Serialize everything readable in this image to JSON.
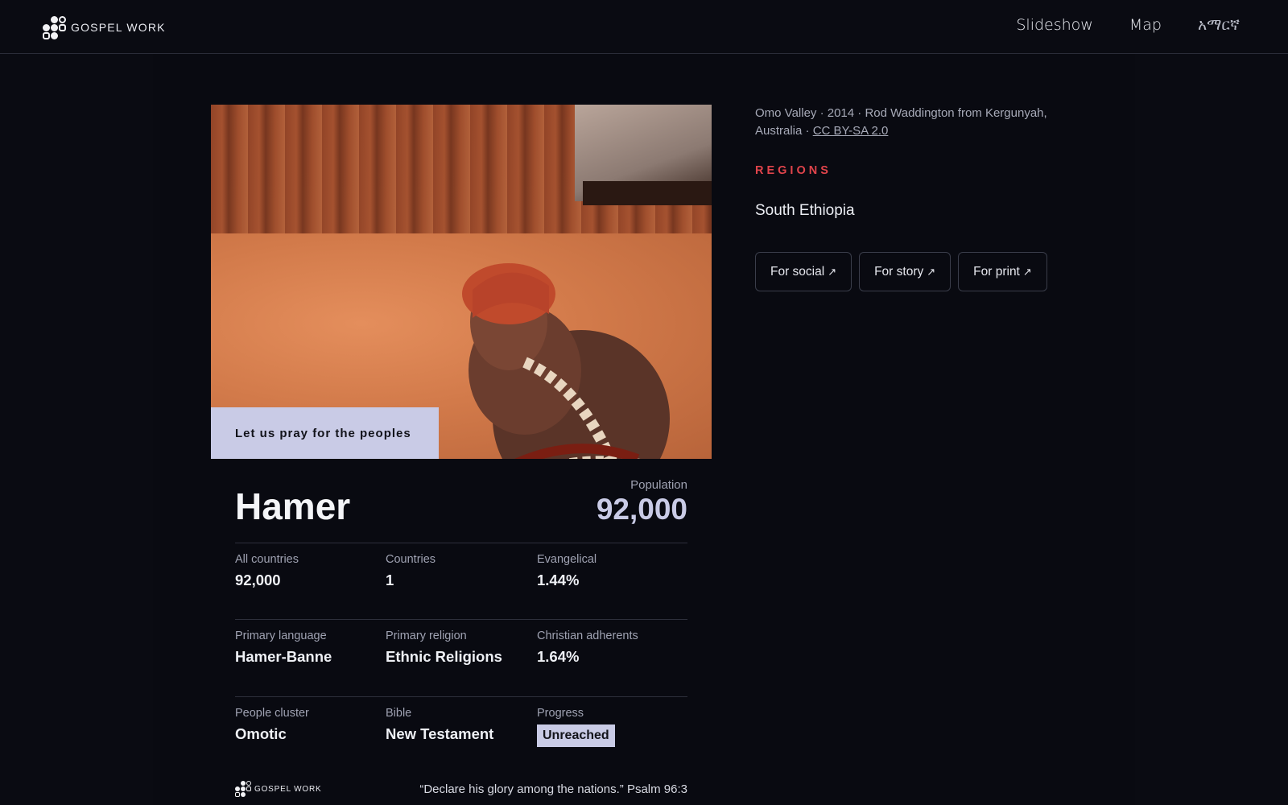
{
  "header": {
    "logo_text": "GOSPEL WORK",
    "nav": {
      "slideshow": "Slideshow",
      "map": "Map",
      "language": "አማርኛ"
    }
  },
  "photo": {
    "caption": "Let us pray for the peoples"
  },
  "people": {
    "name": "Hamer",
    "population_label": "Population",
    "population_value": "92,000"
  },
  "stats": {
    "all_countries": {
      "label": "All countries",
      "value": "92,000"
    },
    "countries": {
      "label": "Countries",
      "value": "1"
    },
    "evangelical": {
      "label": "Evangelical",
      "value": "1.44%"
    },
    "primary_language": {
      "label": "Primary language",
      "value": "Hamer-Banne"
    },
    "primary_religion": {
      "label": "Primary religion",
      "value": "Ethnic Religions"
    },
    "christian_adherents": {
      "label": "Christian adherents",
      "value": "1.64%"
    },
    "people_cluster": {
      "label": "People cluster",
      "value": "Omotic"
    },
    "bible": {
      "label": "Bible",
      "value": "New Testament"
    },
    "progress": {
      "label": "Progress",
      "value": "Unreached"
    }
  },
  "footer": {
    "logo_text": "GOSPEL WORK",
    "quote": "“Declare his glory among the nations.” Psalm 96:3"
  },
  "sidebar": {
    "credit_text": "Omo Valley · 2014 · Rod Waddington from Kergunyah, Australia · ",
    "license": "CC BY-SA 2.0",
    "regions_label": "REGIONS",
    "region": "South Ethiopia",
    "buttons": {
      "social": "For social",
      "story": "For story",
      "print": "For print",
      "arrow": "↗"
    }
  },
  "colors": {
    "background": "#0a0b12",
    "accent_red": "#e0444b",
    "badge": "#c9cbe6"
  }
}
